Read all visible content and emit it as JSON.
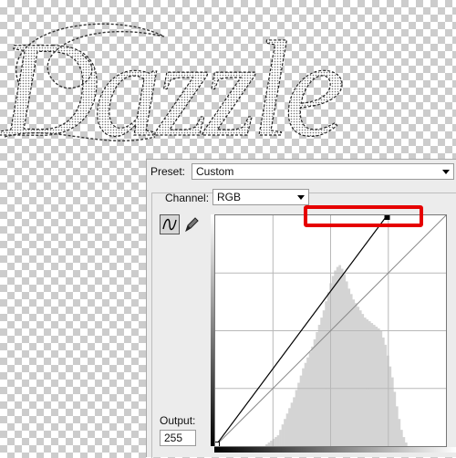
{
  "canvas": {
    "text": "Dazzle",
    "artwork": "dazzle-script-text"
  },
  "curves_dialog": {
    "preset_label": "Preset:",
    "preset_value": "Custom",
    "channel_label": "Channel:",
    "channel_value": "RGB",
    "tools": [
      "curve-tool-icon",
      "pencil-tool-icon"
    ],
    "output_label": "Output:",
    "output_value": "255",
    "curve": {
      "points": [
        [
          0,
          0
        ],
        [
          190,
          255
        ]
      ],
      "baseline": [
        [
          0,
          0
        ],
        [
          255,
          255
        ]
      ]
    },
    "histogram_levels": [
      0,
      0,
      0,
      0,
      0,
      0,
      0,
      0,
      0,
      0,
      0,
      0,
      0,
      0,
      0,
      0,
      0,
      0,
      0,
      0,
      0,
      0,
      2,
      4,
      6,
      8,
      10,
      12,
      18,
      24,
      30,
      36,
      42,
      48,
      54,
      62,
      70,
      78,
      86,
      92,
      98,
      104,
      110,
      118,
      126,
      134,
      142,
      150,
      160,
      170,
      180,
      188,
      194,
      198,
      200,
      196,
      190,
      182,
      174,
      168,
      162,
      158,
      154,
      150,
      146,
      142,
      140,
      138,
      136,
      134,
      132,
      130,
      128,
      120,
      112,
      100,
      88,
      76,
      60,
      44,
      30,
      18,
      10,
      4,
      0,
      0,
      0,
      0,
      0,
      0,
      0,
      0,
      0,
      0,
      0,
      0,
      0,
      0,
      0,
      0,
      0
    ],
    "highlight_color": "#e60000"
  }
}
